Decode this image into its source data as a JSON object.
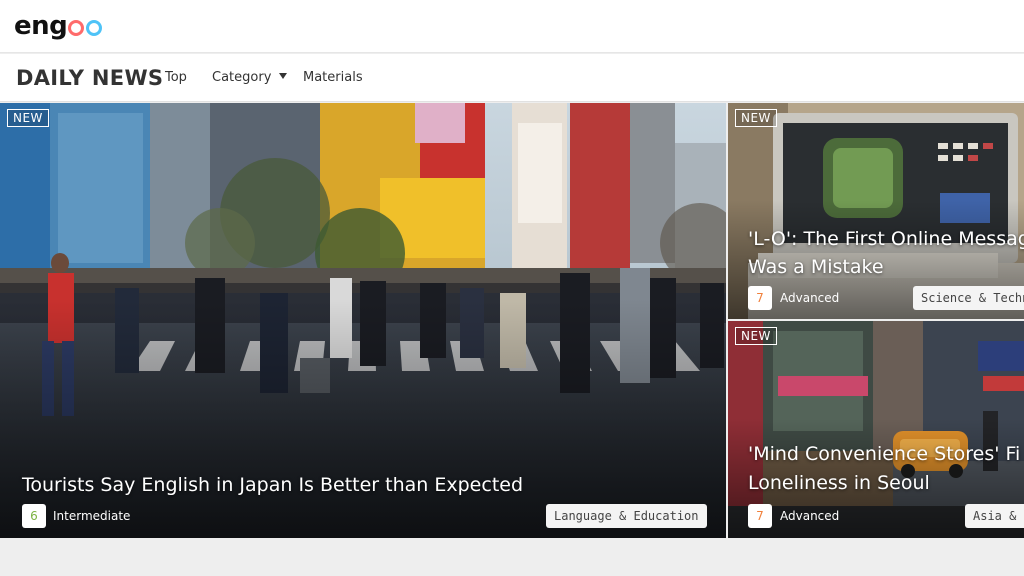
{
  "header": {
    "logo_letters": [
      "e",
      "n",
      "g"
    ],
    "logo_colors": [
      "#ff6b6b",
      "#4fc3f7"
    ],
    "site_name": "engoo"
  },
  "nav": {
    "brand": "DAILY NEWS",
    "items": [
      {
        "label": "Top"
      },
      {
        "label": "Category"
      },
      {
        "label": "Materials"
      }
    ]
  },
  "articles": [
    {
      "badge": "NEW",
      "title": "Tourists Say English in Japan Is Better than Expected",
      "level": "6",
      "level_label": "Intermediate",
      "level_color": "#7cb342",
      "tag": "Language & Education"
    },
    {
      "badge": "NEW",
      "title_line1": "'L-O': The First Online Messag",
      "title_line2": "Was a Mistake",
      "level": "7",
      "level_label": "Advanced",
      "level_color": "#f0803c",
      "tag": "Science & Techn"
    },
    {
      "badge": "NEW",
      "title_line1": "'Mind Convenience Stores' Fi",
      "title_line2": "Loneliness in Seoul",
      "level": "7",
      "level_label": "Advanced",
      "level_color": "#f0803c",
      "tag": "Asia & P"
    }
  ]
}
